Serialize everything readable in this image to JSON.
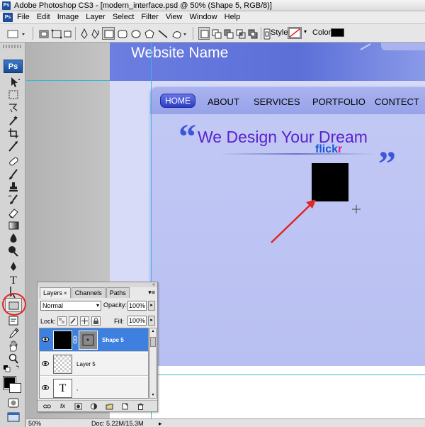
{
  "window": {
    "title": "Adobe Photoshop CS3 - [modern_interface.psd @ 50% (Shape 5, RGB/8)]",
    "app_badge": "Ps"
  },
  "menu": {
    "items": [
      "File",
      "Edit",
      "Image",
      "Layer",
      "Select",
      "Filter",
      "View",
      "Window",
      "Help"
    ]
  },
  "options_bar": {
    "style_label": "Style:",
    "color_label": "Color:",
    "color_value": "#000000"
  },
  "toolbox": {
    "logo": "Ps",
    "foreground": "#000000",
    "background": "#ffffff"
  },
  "canvas": {
    "site_name": "Website Name",
    "nav": [
      "HOME",
      "ABOUT",
      "SERVICES",
      "PORTFOLIO",
      "CONTECT"
    ],
    "quote_open": "“",
    "quote_close": "”",
    "tagline": "We Design Your Dream",
    "flickr_part1": "flick",
    "flickr_part2": "r",
    "colors": {
      "header": "#6c7ee0",
      "tagline": "#5a22cc",
      "quote": "#3c56dc",
      "nav_active": "#3344cc",
      "annotation": "#e22525"
    }
  },
  "status": {
    "zoom": "50%",
    "doc": "Doc: 5.22M/15.3M"
  },
  "layers_panel": {
    "tabs": [
      "Layers",
      "Channels",
      "Paths"
    ],
    "tab_close": "×",
    "blend_mode": "Normal",
    "opacity_label": "Opacity:",
    "opacity_value": "100%",
    "lock_label": "Lock:",
    "fill_label": "Fill:",
    "fill_value": "100%",
    "layers": [
      {
        "name": "Shape 5",
        "selected": true
      },
      {
        "name": "Layer 5",
        "selected": false
      },
      {
        "name": ",",
        "selected": false
      }
    ],
    "type_glyph": "T",
    "bottom_icons": [
      "link-icon",
      "fx-icon",
      "mask-icon",
      "adjustment-icon",
      "group-icon",
      "new-layer-icon",
      "trash-icon"
    ]
  }
}
